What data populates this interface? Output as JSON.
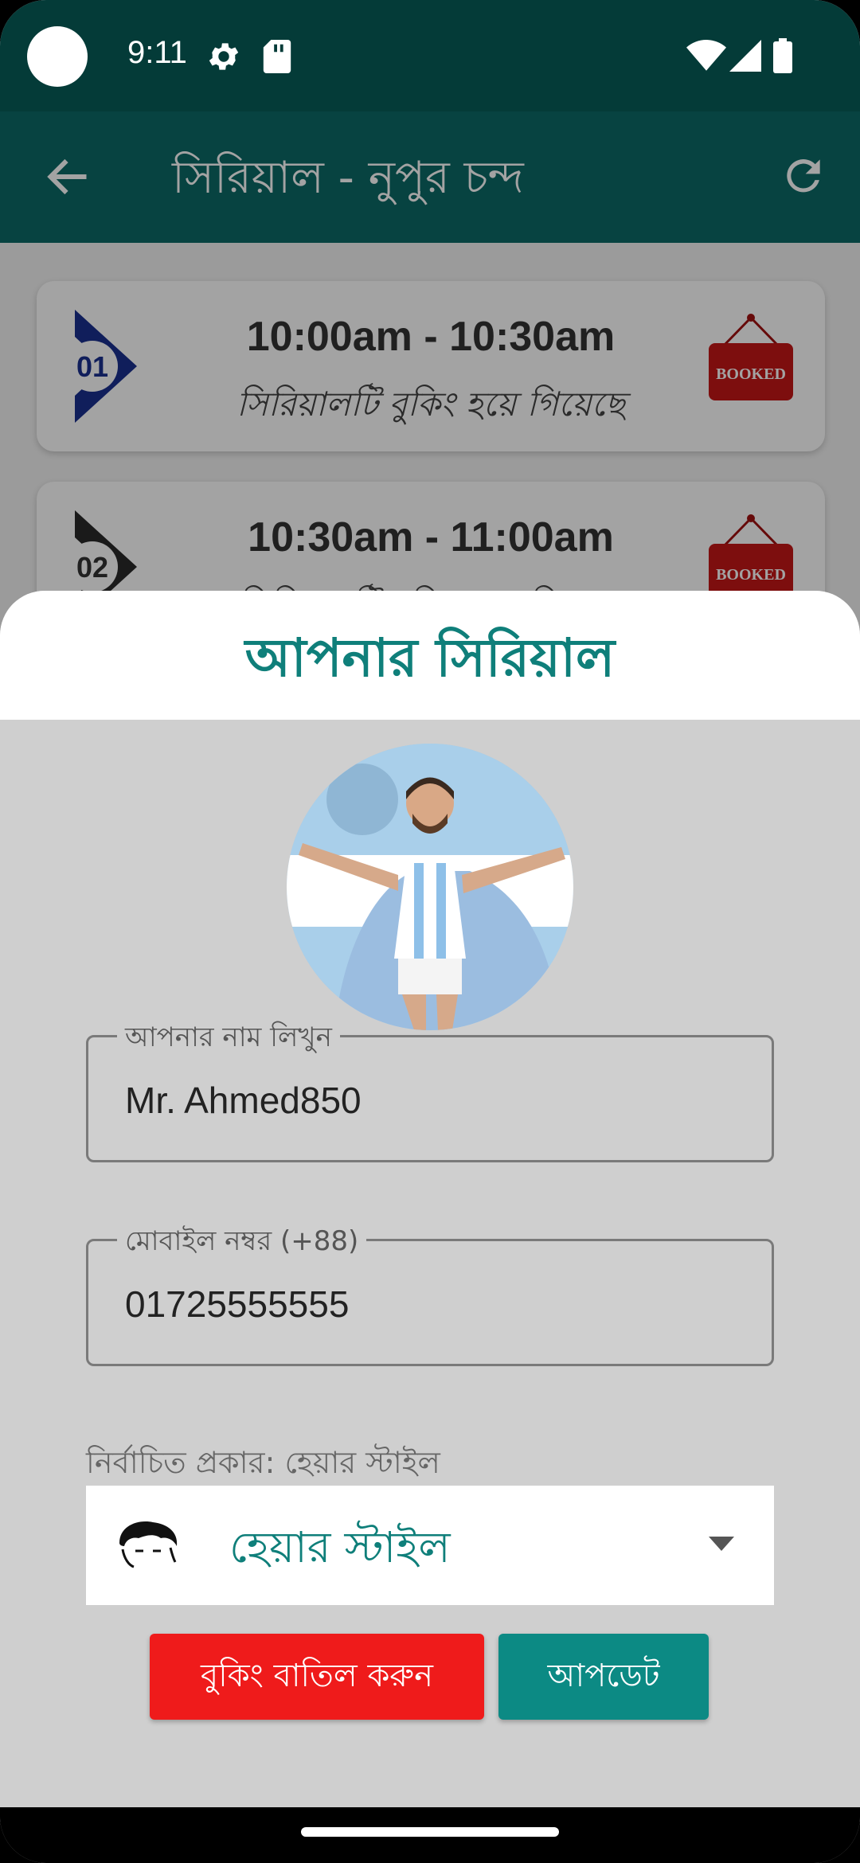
{
  "status_bar": {
    "time": "9:11"
  },
  "app_bar": {
    "title": "সিরিয়াল - নুপুর চন্দ"
  },
  "slots": [
    {
      "number": "01",
      "time": "10:00am - 10:30am",
      "status": "সিরিয়ালটি বুকিং হয়ে গিয়েছে",
      "badge": "BOOKED"
    },
    {
      "number": "02",
      "time": "10:30am - 11:00am",
      "status": "সিরিয়ালটি বুকিং হয়ে গিয়েছে",
      "badge": "BOOKED"
    }
  ],
  "sheet": {
    "title": "আপনার সিরিয়াল",
    "name_field": {
      "label": "আপনার নাম লিখুন",
      "value": "Mr. Ahmed850"
    },
    "mobile_field": {
      "label": "মোবাইল নম্বর (+88)",
      "value": "01725555555"
    },
    "selected_type": "নির্বাচিত প্রকার: হেয়ার স্টাইল",
    "service_dropdown": {
      "selected": "হেয়ার স্টাইল",
      "icon": "hair-style-icon"
    },
    "cancel_button": "বুকিং বাতিল করুন",
    "update_button": "আপডেট"
  },
  "colors": {
    "status_bar": "#043b38",
    "app_bar": "#0c6a66",
    "accent": "#0f7f7a",
    "cancel": "#ef1b1b",
    "update": "#0c8a84"
  }
}
